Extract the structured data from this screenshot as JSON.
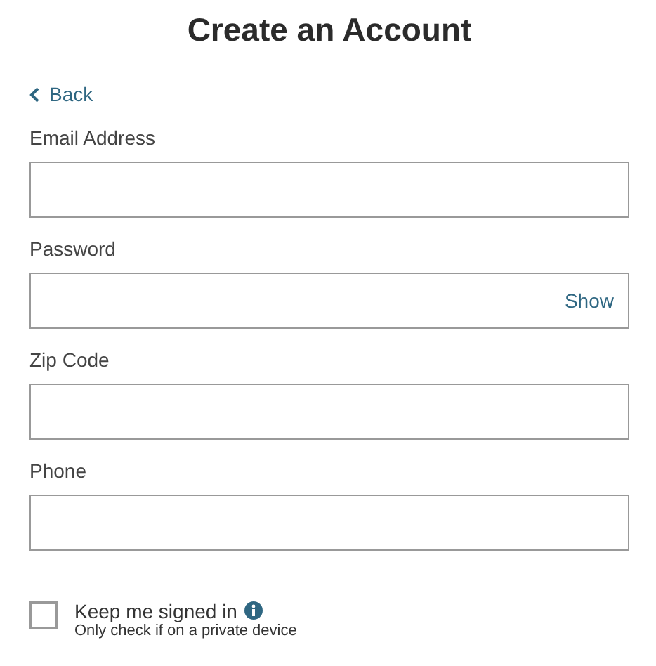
{
  "title": "Create an Account",
  "back": {
    "label": "Back"
  },
  "fields": [
    {
      "label": "Email Address",
      "kind": "text"
    },
    {
      "label": "Password",
      "kind": "password",
      "toggle": "Show"
    },
    {
      "label": "Zip Code",
      "kind": "text"
    },
    {
      "label": "Phone",
      "kind": "text"
    }
  ],
  "keep_signed_in": {
    "label": "Keep me signed in",
    "hint": "Only check if on a private device",
    "checked": false
  }
}
